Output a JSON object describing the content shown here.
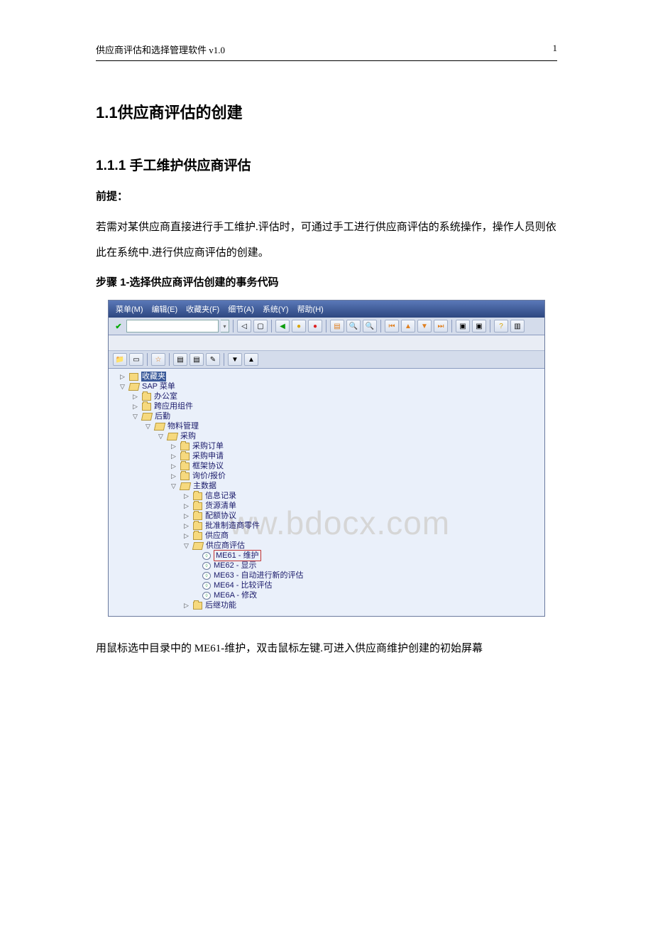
{
  "doc": {
    "header_title": "供应商评估和选择管理软件   v1.0",
    "page_number": "1",
    "h1": "1.1供应商评估的创建",
    "h2": "1.1.1 手工维护供应商评估",
    "premise_label": "前提：",
    "premise_text": "若需对某供应商直接进行手工维护.评估时，可通过手工进行供应商评估的系统操作，操作人员则依此在系统中.进行供应商评估的创建。",
    "step_label": "步骤 1-选择供应商评估创建的事务代码",
    "after_text": "用鼠标选中目录中的 ME61-维护，双击鼠标左键.可进入供应商维护创建的初始屏幕"
  },
  "sap": {
    "menu": {
      "m": "菜单(M)",
      "e": "编辑(E)",
      "f": "收藏夹(F)",
      "a": "细节(A)",
      "y": "系统(Y)",
      "h": "帮助(H)"
    },
    "watermark": "ww.bdocx.com",
    "tree": {
      "fav": "收藏夹",
      "sapmenu": "SAP 菜单",
      "office": "办公室",
      "cross": "跨应用组件",
      "logistics": "后勤",
      "mm": "物料管理",
      "purchasing": "采购",
      "po": "采购订单",
      "pr": "采购申请",
      "outline": "框架协议",
      "rfq": "询价/报价",
      "master": "主数据",
      "info": "信息记录",
      "source": "货源清单",
      "quota": "配额协议",
      "apl": "批准制造商零件",
      "vendor": "供应商",
      "vendoreval": "供应商评估",
      "me61": "ME61 - 维护",
      "me62": "ME62 - 显示",
      "me63": "ME63 - 自动进行新的评估",
      "me64": "ME64 - 比较评估",
      "me6a": "ME6A - 修改",
      "follow": "后继功能"
    }
  }
}
